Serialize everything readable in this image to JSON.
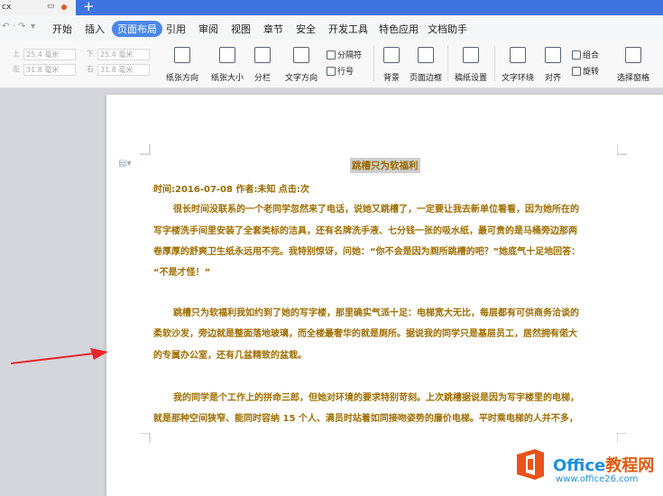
{
  "titlebar": {
    "tab_name": "cx",
    "new_tab": "+"
  },
  "menu": {
    "quick": [
      "↶",
      "·",
      "↷",
      "▾"
    ],
    "items": [
      "开始",
      "插入",
      "页面布局",
      "引用",
      "审阅",
      "视图",
      "章节",
      "安全",
      "开发工具",
      "特色应用",
      "文档助手"
    ],
    "active": "页面布局"
  },
  "margins": {
    "top_label": "上",
    "top_value": "25.4 毫米",
    "bottom_label": "下",
    "bottom_value": "25.4 毫米",
    "left_label": "左",
    "left_value": "31.8 毫米",
    "right_label": "右",
    "right_value": "31.8 毫米"
  },
  "toolbar": {
    "orientation": "纸张方向",
    "size": "纸张大小",
    "columns": "分栏",
    "text_direction": "文字方向",
    "break": "分隔符",
    "line_number": "行号",
    "background": "背景",
    "border": "页面边框",
    "manuscript": "稿纸设置",
    "wrap": "文字环绕",
    "align": "对齐",
    "group": "组合",
    "rotate": "旋转",
    "select_pane": "选择窗格"
  },
  "document": {
    "title": "跳槽只为软福利",
    "meta": "时间:2016-07-08  作者:未知  点击:次",
    "lines": [
      "很长时间没联系的一个老同学忽然来了电话，说她又跳槽了，一定要让我去新单位看看，因为她所在的",
      "写字楼洗手间里安装了全套类标的洁具，还有名牌洗手液、七分钱一张的吸水纸，最可贵的是马桶旁边那两",
      "卷厚厚的舒爽卫生纸永远用不完。我特别惊讶，问她：“你不会是因为厕所跳槽的吧？”她底气十足地回答：",
      "“不是才怪！”",
      "跳槽只为软福利我如约到了她的写字楼，那里确实气派十足：电梯宽大无比，每层都有可供商务洽谈的",
      "柔软沙发，旁边就是整面落地玻璃，而全楼最奢华的就是厕所。据说我的同学只是基层员工，居然拥有偌大",
      "的专属办公室，还有几盆精致的盆栽。",
      "我的同学是个工作上的拼命三郎，但她对环境的要求特别苛刻。上次跳槽据说是因为写字楼里的电梯，",
      "就是那种空间狭窄、能同时容纳 15 个人、满员时站着如同接吻姿势的廉价电梯。平时乘电梯的人并不多，"
    ]
  },
  "watermark": {
    "brand": "Office",
    "brand_cn": "教程网",
    "url": "www.office26.com"
  }
}
